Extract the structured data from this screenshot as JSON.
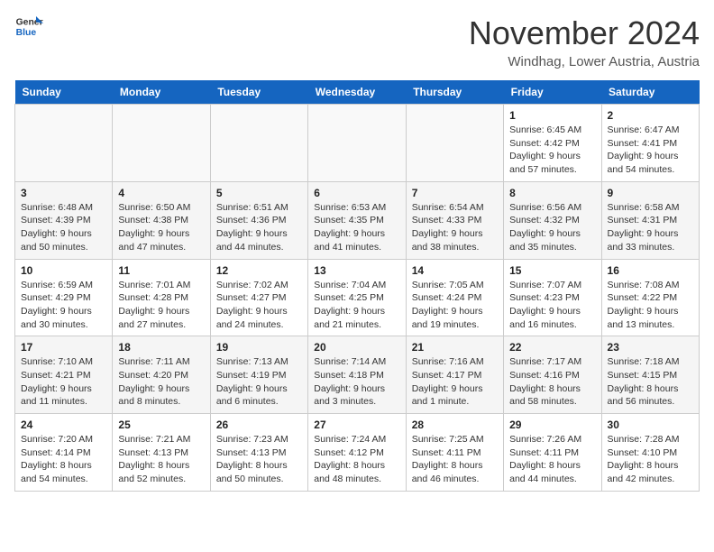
{
  "header": {
    "logo_line1": "General",
    "logo_line2": "Blue",
    "month": "November 2024",
    "location": "Windhag, Lower Austria, Austria"
  },
  "weekdays": [
    "Sunday",
    "Monday",
    "Tuesday",
    "Wednesday",
    "Thursday",
    "Friday",
    "Saturday"
  ],
  "weeks": [
    [
      {
        "day": "",
        "info": ""
      },
      {
        "day": "",
        "info": ""
      },
      {
        "day": "",
        "info": ""
      },
      {
        "day": "",
        "info": ""
      },
      {
        "day": "",
        "info": ""
      },
      {
        "day": "1",
        "info": "Sunrise: 6:45 AM\nSunset: 4:42 PM\nDaylight: 9 hours and 57 minutes."
      },
      {
        "day": "2",
        "info": "Sunrise: 6:47 AM\nSunset: 4:41 PM\nDaylight: 9 hours and 54 minutes."
      }
    ],
    [
      {
        "day": "3",
        "info": "Sunrise: 6:48 AM\nSunset: 4:39 PM\nDaylight: 9 hours and 50 minutes."
      },
      {
        "day": "4",
        "info": "Sunrise: 6:50 AM\nSunset: 4:38 PM\nDaylight: 9 hours and 47 minutes."
      },
      {
        "day": "5",
        "info": "Sunrise: 6:51 AM\nSunset: 4:36 PM\nDaylight: 9 hours and 44 minutes."
      },
      {
        "day": "6",
        "info": "Sunrise: 6:53 AM\nSunset: 4:35 PM\nDaylight: 9 hours and 41 minutes."
      },
      {
        "day": "7",
        "info": "Sunrise: 6:54 AM\nSunset: 4:33 PM\nDaylight: 9 hours and 38 minutes."
      },
      {
        "day": "8",
        "info": "Sunrise: 6:56 AM\nSunset: 4:32 PM\nDaylight: 9 hours and 35 minutes."
      },
      {
        "day": "9",
        "info": "Sunrise: 6:58 AM\nSunset: 4:31 PM\nDaylight: 9 hours and 33 minutes."
      }
    ],
    [
      {
        "day": "10",
        "info": "Sunrise: 6:59 AM\nSunset: 4:29 PM\nDaylight: 9 hours and 30 minutes."
      },
      {
        "day": "11",
        "info": "Sunrise: 7:01 AM\nSunset: 4:28 PM\nDaylight: 9 hours and 27 minutes."
      },
      {
        "day": "12",
        "info": "Sunrise: 7:02 AM\nSunset: 4:27 PM\nDaylight: 9 hours and 24 minutes."
      },
      {
        "day": "13",
        "info": "Sunrise: 7:04 AM\nSunset: 4:25 PM\nDaylight: 9 hours and 21 minutes."
      },
      {
        "day": "14",
        "info": "Sunrise: 7:05 AM\nSunset: 4:24 PM\nDaylight: 9 hours and 19 minutes."
      },
      {
        "day": "15",
        "info": "Sunrise: 7:07 AM\nSunset: 4:23 PM\nDaylight: 9 hours and 16 minutes."
      },
      {
        "day": "16",
        "info": "Sunrise: 7:08 AM\nSunset: 4:22 PM\nDaylight: 9 hours and 13 minutes."
      }
    ],
    [
      {
        "day": "17",
        "info": "Sunrise: 7:10 AM\nSunset: 4:21 PM\nDaylight: 9 hours and 11 minutes."
      },
      {
        "day": "18",
        "info": "Sunrise: 7:11 AM\nSunset: 4:20 PM\nDaylight: 9 hours and 8 minutes."
      },
      {
        "day": "19",
        "info": "Sunrise: 7:13 AM\nSunset: 4:19 PM\nDaylight: 9 hours and 6 minutes."
      },
      {
        "day": "20",
        "info": "Sunrise: 7:14 AM\nSunset: 4:18 PM\nDaylight: 9 hours and 3 minutes."
      },
      {
        "day": "21",
        "info": "Sunrise: 7:16 AM\nSunset: 4:17 PM\nDaylight: 9 hours and 1 minute."
      },
      {
        "day": "22",
        "info": "Sunrise: 7:17 AM\nSunset: 4:16 PM\nDaylight: 8 hours and 58 minutes."
      },
      {
        "day": "23",
        "info": "Sunrise: 7:18 AM\nSunset: 4:15 PM\nDaylight: 8 hours and 56 minutes."
      }
    ],
    [
      {
        "day": "24",
        "info": "Sunrise: 7:20 AM\nSunset: 4:14 PM\nDaylight: 8 hours and 54 minutes."
      },
      {
        "day": "25",
        "info": "Sunrise: 7:21 AM\nSunset: 4:13 PM\nDaylight: 8 hours and 52 minutes."
      },
      {
        "day": "26",
        "info": "Sunrise: 7:23 AM\nSunset: 4:13 PM\nDaylight: 8 hours and 50 minutes."
      },
      {
        "day": "27",
        "info": "Sunrise: 7:24 AM\nSunset: 4:12 PM\nDaylight: 8 hours and 48 minutes."
      },
      {
        "day": "28",
        "info": "Sunrise: 7:25 AM\nSunset: 4:11 PM\nDaylight: 8 hours and 46 minutes."
      },
      {
        "day": "29",
        "info": "Sunrise: 7:26 AM\nSunset: 4:11 PM\nDaylight: 8 hours and 44 minutes."
      },
      {
        "day": "30",
        "info": "Sunrise: 7:28 AM\nSunset: 4:10 PM\nDaylight: 8 hours and 42 minutes."
      }
    ]
  ]
}
